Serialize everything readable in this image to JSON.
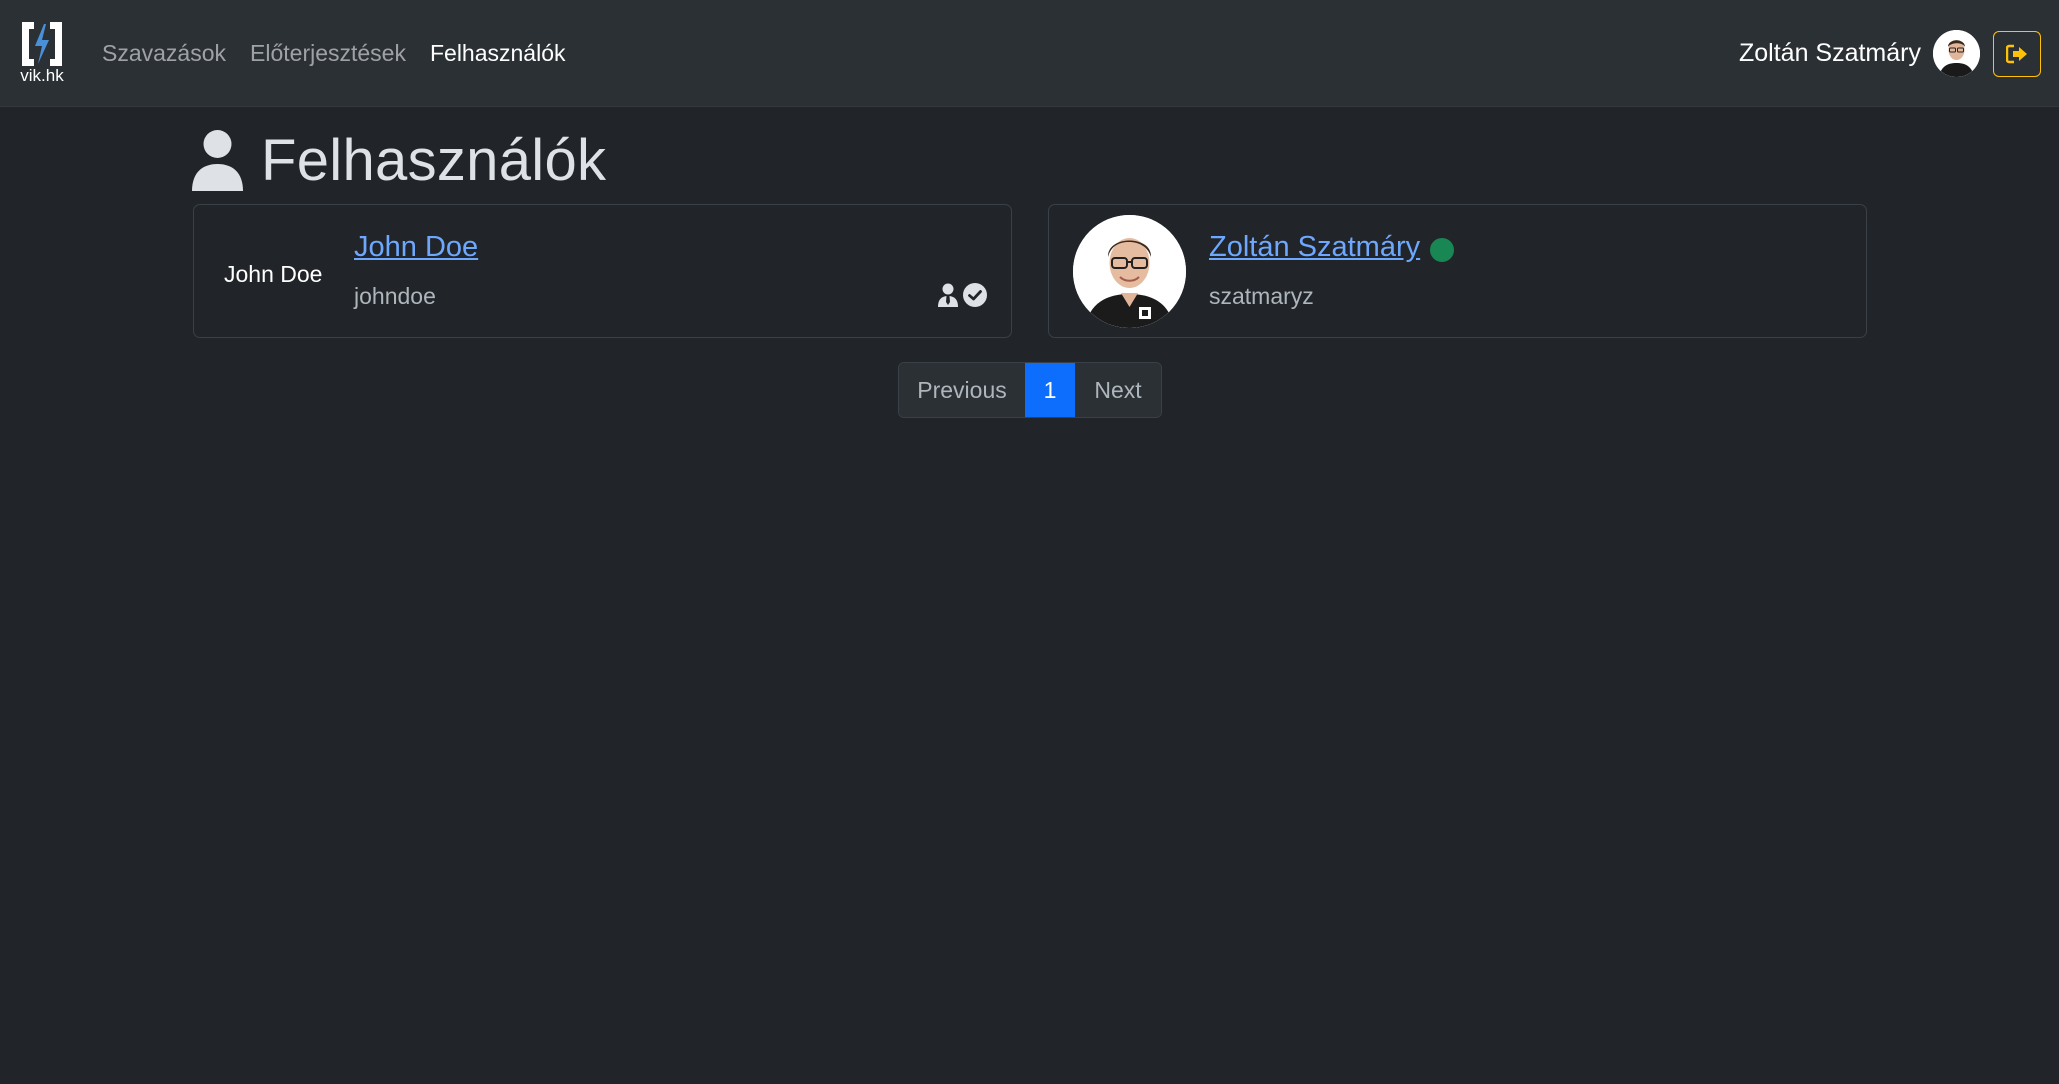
{
  "brand": {
    "text": "vik.hk",
    "icon": "vik-hk-logo"
  },
  "nav": {
    "links": [
      {
        "label": "Szavazások",
        "active": false
      },
      {
        "label": "Előterjesztések",
        "active": false
      },
      {
        "label": "Felhasználók",
        "active": true
      }
    ]
  },
  "user": {
    "name": "Zoltán Szatmáry",
    "avatar": "user-avatar-photo",
    "logout_icon": "sign-out-icon"
  },
  "page": {
    "title": "Felhasználók",
    "title_icon": "user-icon"
  },
  "users": [
    {
      "avatar_alt": "John Doe",
      "name": "John Doe",
      "username": "johndoe",
      "badges": [
        "user-tie-icon",
        "circle-check-icon"
      ]
    },
    {
      "avatar": "user-photo",
      "name": "Zoltán Szatmáry",
      "username": "szatmaryz",
      "online": true,
      "online_color": "#198754"
    }
  ],
  "pagination": {
    "previous": "Previous",
    "current": "1",
    "next": "Next"
  },
  "colors": {
    "background": "#212529",
    "navbar": "#2b3035",
    "link": "#6ea8fe",
    "primary": "#0d6efd",
    "warning": "#ffc107"
  }
}
